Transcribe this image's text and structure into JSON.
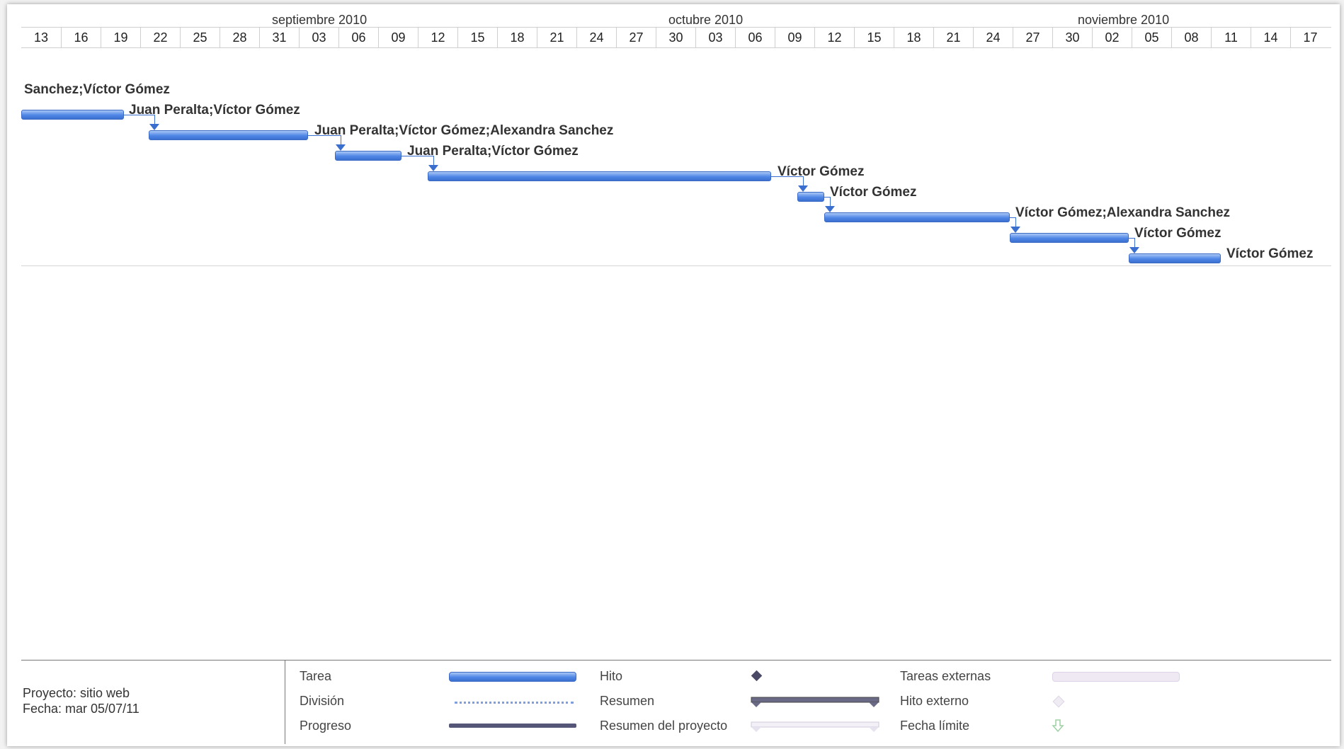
{
  "timescale": {
    "months": [
      "septiembre 2010",
      "octubre 2010",
      "noviembre 2010"
    ],
    "days": [
      "13",
      "16",
      "19",
      "22",
      "25",
      "28",
      "31",
      "03",
      "06",
      "09",
      "12",
      "15",
      "18",
      "21",
      "24",
      "27",
      "30",
      "03",
      "06",
      "09",
      "12",
      "15",
      "18",
      "21",
      "24",
      "27",
      "30",
      "02",
      "05",
      "08",
      "11",
      "14",
      "17"
    ]
  },
  "tasks": [
    {
      "resources": "Sanchez;Víctor Gómez"
    },
    {
      "resources": "Juan Peralta;Víctor Gómez"
    },
    {
      "resources": "Juan Peralta;Víctor Gómez;Alexandra Sanchez"
    },
    {
      "resources": "Juan Peralta;Víctor Gómez"
    },
    {
      "resources": "Víctor Gómez"
    },
    {
      "resources": "Víctor Gómez"
    },
    {
      "resources": "Víctor Gómez;Alexandra Sanchez"
    },
    {
      "resources": "Víctor Gómez"
    },
    {
      "resources": "Víctor Gómez"
    }
  ],
  "footer": {
    "project": "Proyecto: sitio web",
    "date": "Fecha: mar 05/07/11"
  },
  "legend": {
    "tarea": "Tarea",
    "division": "División",
    "progreso": "Progreso",
    "hito": "Hito",
    "resumen": "Resumen",
    "resumen_proyecto": "Resumen del proyecto",
    "tareas_externas": "Tareas externas",
    "hito_externo": "Hito externo",
    "fecha_limite": "Fecha límite"
  },
  "colors": {
    "task_bar": "#4f86e6",
    "connector": "#3b6fcf",
    "progress": "#555577"
  }
}
